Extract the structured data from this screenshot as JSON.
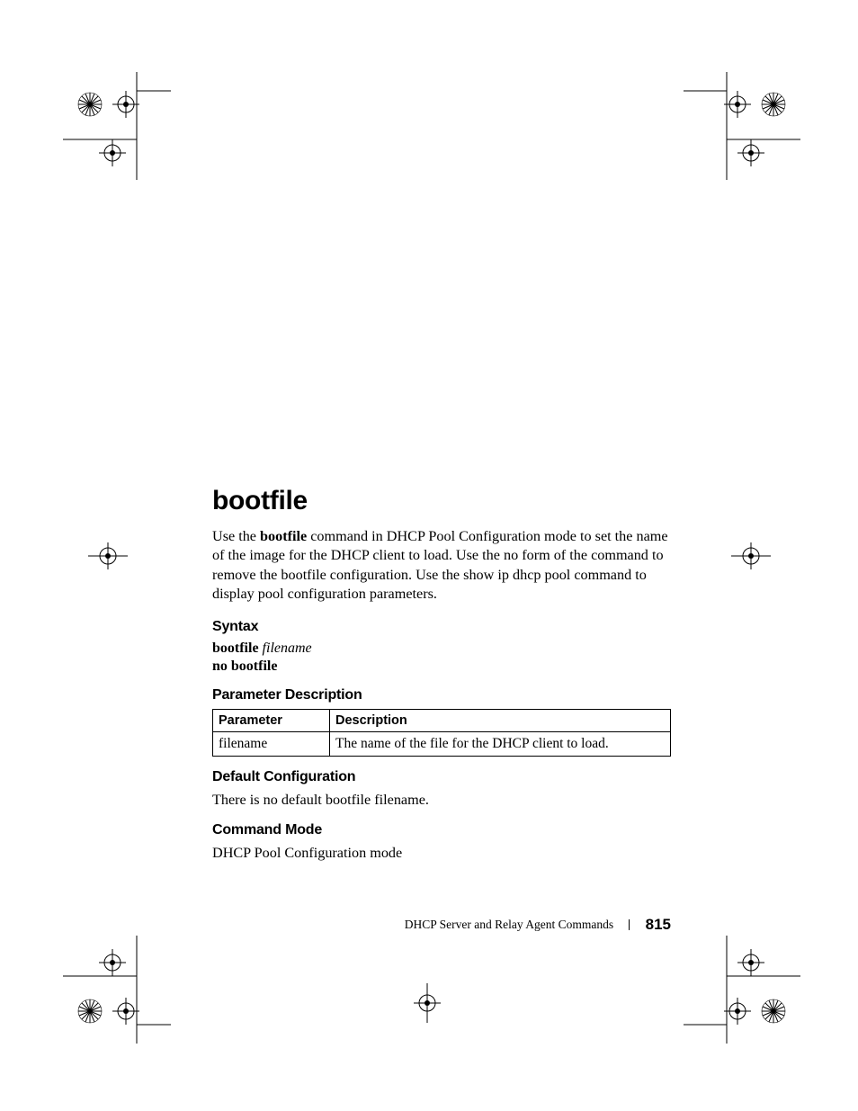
{
  "heading": "bootfile",
  "intro_parts": {
    "p1a": "Use the ",
    "p1b": "bootfile",
    "p1c": " command in DHCP Pool Configuration mode to set the name of the image for the DHCP client to load. Use the no form of the command to remove the bootfile configuration. Use the show ip dhcp pool command to display pool configuration parameters."
  },
  "syntax": {
    "title": "Syntax",
    "line1_cmd": "bootfile",
    "line1_arg": "filename",
    "line2": "no bootfile"
  },
  "param_desc": {
    "title": "Parameter Description",
    "headers": {
      "parameter": "Parameter",
      "description": "Description"
    },
    "rows": [
      {
        "parameter": "filename",
        "description": "The name of the file for the DHCP client to load."
      }
    ]
  },
  "default_cfg": {
    "title": "Default Configuration",
    "text": "There is no default bootfile filename."
  },
  "command_mode": {
    "title": "Command Mode",
    "text": "DHCP Pool Configuration mode"
  },
  "footer": {
    "section": "DHCP Server and Relay Agent Commands",
    "page": "815"
  }
}
